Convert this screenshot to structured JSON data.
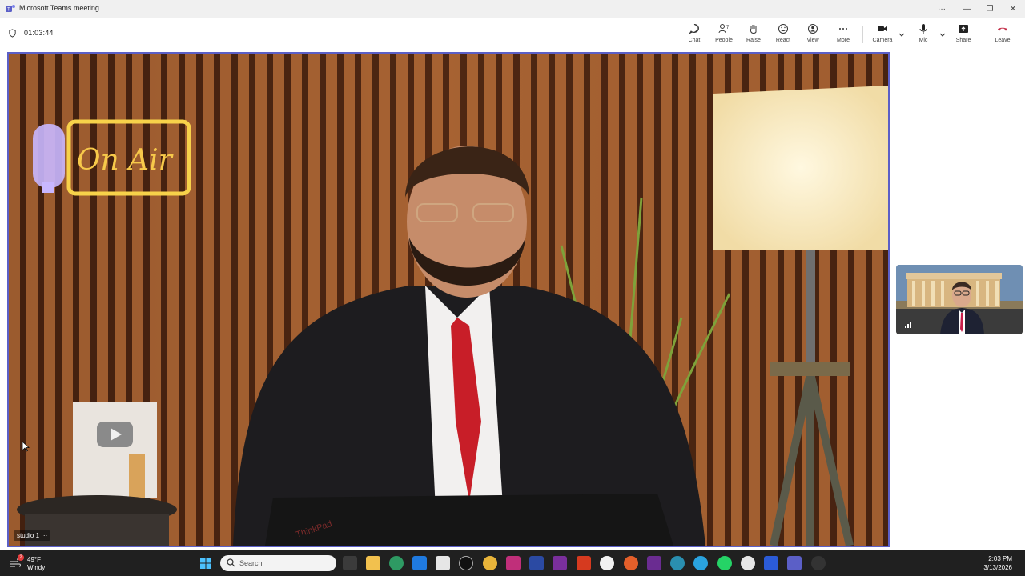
{
  "window": {
    "title": "Microsoft Teams meeting"
  },
  "meeting": {
    "elapsed": "01:03:44"
  },
  "toolbar": {
    "chat": "Chat",
    "people": "People",
    "people_count": "7",
    "raise": "Raise",
    "react": "React",
    "view": "View",
    "more": "More",
    "camera": "Camera",
    "mic": "Mic",
    "share": "Share",
    "leave": "Leave"
  },
  "main_video": {
    "participant": "studio 1",
    "more": "···",
    "sign_text": "On Air",
    "laptop_brand": "ThinkPad"
  },
  "taskbar": {
    "weather_temp": "49°F",
    "weather_cond": "Windy",
    "weather_badge": "2",
    "search_placeholder": "Search",
    "time": "2:03 PM",
    "date": "3/13/2026"
  },
  "colors": {
    "accent": "#5b5fc7",
    "leave": "#c4314b",
    "taskbar": "#202020"
  }
}
